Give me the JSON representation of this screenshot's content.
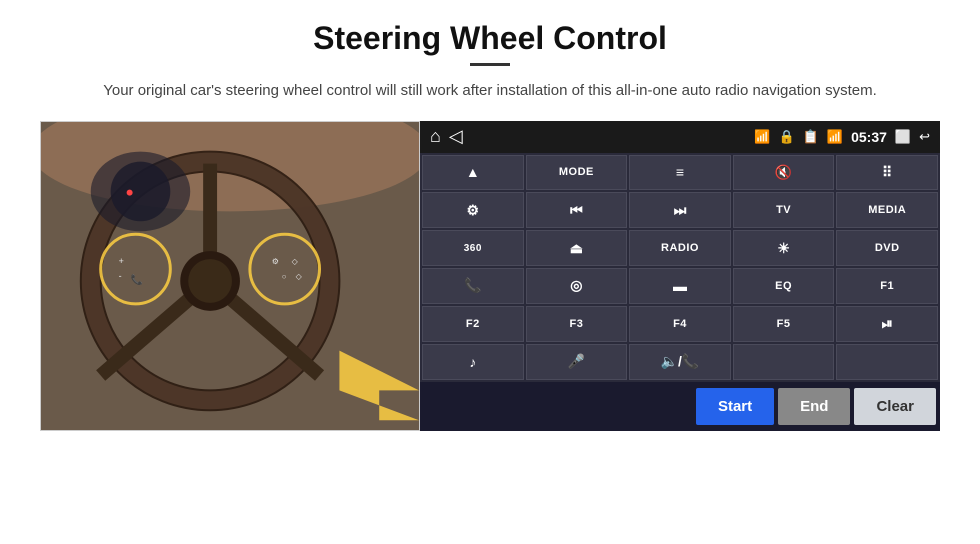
{
  "header": {
    "title": "Steering Wheel Control",
    "subtitle": "Your original car's steering wheel control will still work after installation of this all-in-one auto radio navigation system."
  },
  "topbar": {
    "time": "05:37"
  },
  "buttons": {
    "row1": [
      {
        "icon": "⬆",
        "label": "",
        "type": "icon"
      },
      {
        "icon": "",
        "label": "MODE",
        "type": "text"
      },
      {
        "icon": "≡",
        "label": "",
        "type": "icon"
      },
      {
        "icon": "🔇",
        "label": "",
        "type": "icon"
      },
      {
        "icon": "⠿",
        "label": "",
        "type": "icon"
      }
    ],
    "row2": [
      {
        "icon": "⚙",
        "label": "",
        "type": "icon"
      },
      {
        "icon": "⏮",
        "label": "",
        "type": "icon"
      },
      {
        "icon": "⏭",
        "label": "",
        "type": "icon"
      },
      {
        "icon": "",
        "label": "TV",
        "type": "text"
      },
      {
        "icon": "",
        "label": "MEDIA",
        "type": "text"
      }
    ],
    "row3": [
      {
        "icon": "360",
        "label": "",
        "type": "icon"
      },
      {
        "icon": "⏏",
        "label": "",
        "type": "icon"
      },
      {
        "icon": "",
        "label": "RADIO",
        "type": "text"
      },
      {
        "icon": "☀",
        "label": "",
        "type": "icon"
      },
      {
        "icon": "",
        "label": "DVD",
        "type": "text"
      }
    ],
    "row4": [
      {
        "icon": "📞",
        "label": "",
        "type": "icon"
      },
      {
        "icon": "◎",
        "label": "",
        "type": "icon"
      },
      {
        "icon": "▬",
        "label": "",
        "type": "icon"
      },
      {
        "icon": "",
        "label": "EQ",
        "type": "text"
      },
      {
        "icon": "",
        "label": "F1",
        "type": "text"
      }
    ],
    "row5": [
      {
        "icon": "",
        "label": "F2",
        "type": "text"
      },
      {
        "icon": "",
        "label": "F3",
        "type": "text"
      },
      {
        "icon": "",
        "label": "F4",
        "type": "text"
      },
      {
        "icon": "",
        "label": "F5",
        "type": "text"
      },
      {
        "icon": "⏯",
        "label": "",
        "type": "icon"
      }
    ],
    "row6": [
      {
        "icon": "♪",
        "label": "",
        "type": "icon"
      },
      {
        "icon": "🎤",
        "label": "",
        "type": "icon"
      },
      {
        "icon": "🔈",
        "label": "",
        "type": "icon"
      },
      {
        "icon": "",
        "label": "",
        "type": "empty"
      },
      {
        "icon": "",
        "label": "",
        "type": "empty"
      }
    ]
  },
  "actions": {
    "start": "Start",
    "end": "End",
    "clear": "Clear"
  }
}
